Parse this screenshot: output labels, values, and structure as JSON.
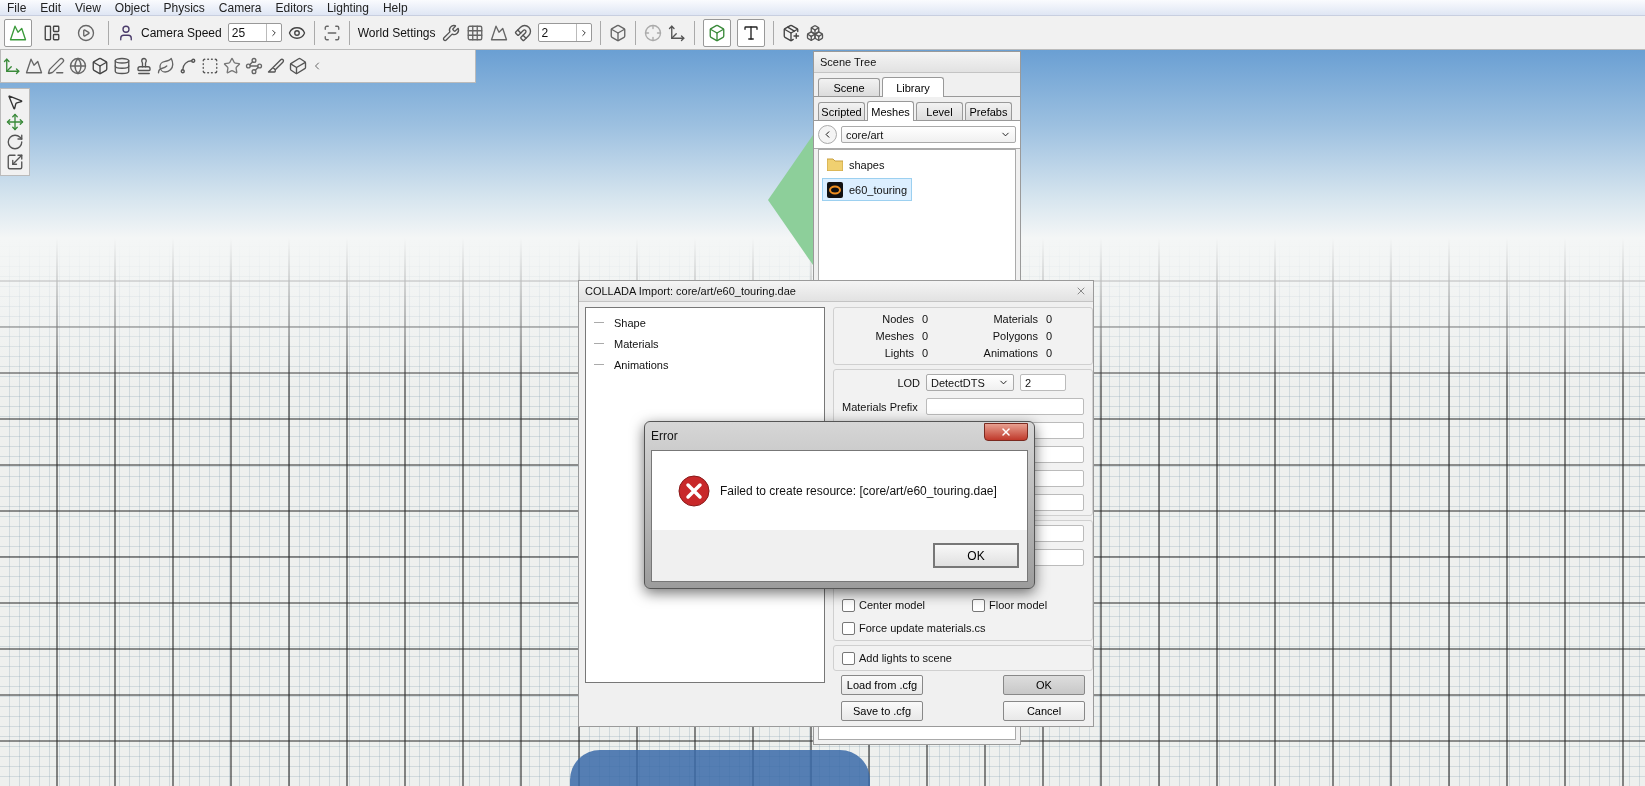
{
  "menu": [
    "File",
    "Edit",
    "View",
    "Object",
    "Physics",
    "Camera",
    "Editors",
    "Lighting",
    "Help"
  ],
  "toolbar": {
    "tools": [
      {
        "selected": true
      },
      {
        "selected": false
      },
      {
        "selected": false
      }
    ],
    "camera_speed_label": "Camera Speed",
    "camera_speed_value": "25",
    "world_settings": "World Settings",
    "snap_value": "2",
    "toggles": [
      {
        "selected": true
      },
      {
        "selected": true
      }
    ]
  },
  "scene_tree": {
    "title": "Scene Tree",
    "tabs": [
      {
        "label": "Scene",
        "selected": false
      },
      {
        "label": "Library",
        "selected": true
      }
    ],
    "subtabs": [
      {
        "label": "Scripted",
        "selected": false
      },
      {
        "label": "Meshes",
        "selected": true
      },
      {
        "label": "Level",
        "selected": false
      },
      {
        "label": "Prefabs",
        "selected": false
      }
    ],
    "path": "core/art",
    "items": [
      {
        "kind": "folder",
        "label": "shapes",
        "selected": false
      },
      {
        "kind": "mesh",
        "label": "e60_touring",
        "selected": true
      }
    ]
  },
  "import_dialog": {
    "title": "COLLADA Import: core/art/e60_touring.dae",
    "tree": [
      "Shape",
      "Materials",
      "Animations"
    ],
    "stats": [
      {
        "label": "Nodes",
        "value": "0"
      },
      {
        "label": "Materials",
        "value": "0"
      },
      {
        "label": "Meshes",
        "value": "0"
      },
      {
        "label": "Polygons",
        "value": "0"
      },
      {
        "label": "Lights",
        "value": "0"
      },
      {
        "label": "Animations",
        "value": "0"
      }
    ],
    "lod_label": "LOD",
    "lod_value": "DetectDTS",
    "lod_size": "2",
    "materials_prefix_label": "Materials Prefix",
    "options": [
      {
        "label": "Center model",
        "checked": false
      },
      {
        "label": "Floor model",
        "checked": false
      },
      {
        "label": "Force update materials.cs",
        "checked": false
      }
    ],
    "add_lights": {
      "label": "Add lights to scene",
      "checked": false
    },
    "buttons": {
      "load": "Load from .cfg",
      "save": "Save to .cfg",
      "ok": "OK",
      "cancel": "Cancel"
    }
  },
  "error_dialog": {
    "title": "Error",
    "message": "Failed to create resource: [core/art/e60_touring.dae]",
    "button": "OK"
  }
}
